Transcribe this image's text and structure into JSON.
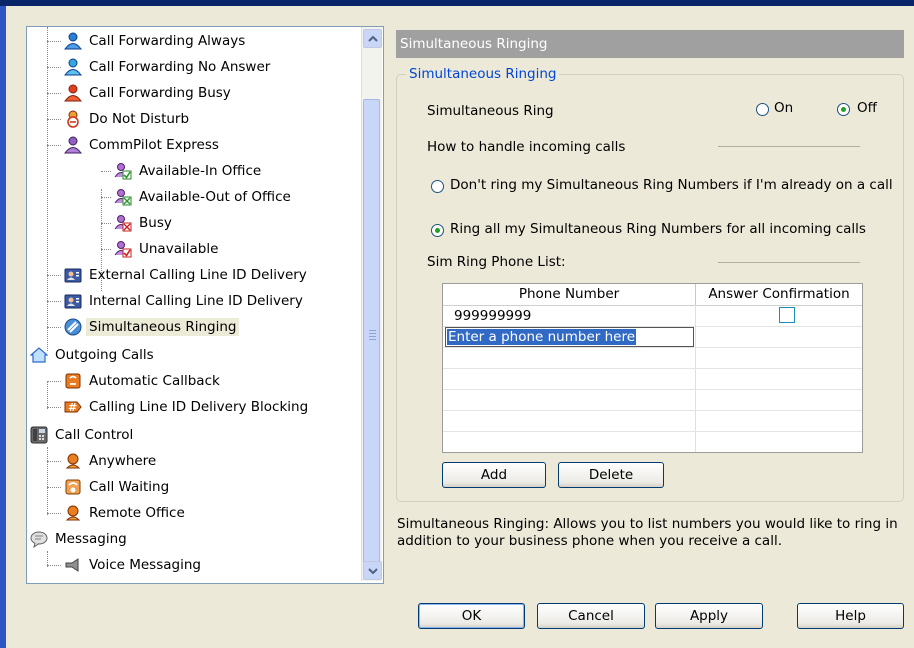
{
  "tree": {
    "items": [
      {
        "label": "Call Forwarding Always",
        "icon": "person-forward-icon"
      },
      {
        "label": "Call Forwarding No Answer",
        "icon": "person-no-answer-icon"
      },
      {
        "label": "Call Forwarding Busy",
        "icon": "person-busy-icon"
      },
      {
        "label": "Do Not Disturb",
        "icon": "person-dnd-icon"
      },
      {
        "label": "CommPilot Express",
        "icon": "person-commpilot-icon"
      },
      {
        "label": "Available-In Office",
        "icon": "available-in-office-icon"
      },
      {
        "label": "Available-Out of Office",
        "icon": "available-out-office-icon"
      },
      {
        "label": "Busy",
        "icon": "busy-status-icon"
      },
      {
        "label": "Unavailable",
        "icon": "unavailable-status-icon"
      },
      {
        "label": "External Calling Line ID Delivery",
        "icon": "caller-id-card-icon"
      },
      {
        "label": "Internal Calling Line ID Delivery",
        "icon": "caller-id-card-icon"
      },
      {
        "label": "Simultaneous Ringing",
        "icon": "simultaneous-ring-icon"
      },
      {
        "label": "Outgoing Calls",
        "icon": "house-icon"
      },
      {
        "label": "Automatic Callback",
        "icon": "callback-phone-icon"
      },
      {
        "label": "Calling Line ID Delivery Blocking",
        "icon": "hash-block-icon"
      },
      {
        "label": "Call Control",
        "icon": "phone-desk-icon"
      },
      {
        "label": "Anywhere",
        "icon": "anywhere-icon"
      },
      {
        "label": "Call Waiting",
        "icon": "call-waiting-icon"
      },
      {
        "label": "Remote Office",
        "icon": "remote-office-icon"
      },
      {
        "label": "Messaging",
        "icon": "speech-bubble-icon"
      },
      {
        "label": "Voice Messaging",
        "icon": "voicemail-icon"
      }
    ]
  },
  "panel": {
    "header": "Simultaneous Ringing",
    "group_title": "Simultaneous Ringing",
    "ring_label": "Simultaneous Ring",
    "on_label": "On",
    "off_label": "Off",
    "ring_selected": "Off",
    "handle_label": "How to handle incoming calls",
    "option_dont_ring": "Don't ring my Simultaneous Ring Numbers if I'm already on a call",
    "option_ring_all": "Ring all my Simultaneous Ring Numbers for all incoming calls",
    "handle_selected": "ring_all",
    "list_label": "Sim Ring Phone List:",
    "table": {
      "headers": [
        "Phone Number",
        "Answer Confirmation"
      ],
      "rows": [
        {
          "number": "999999999",
          "confirm": false
        }
      ],
      "new_entry_placeholder": "Enter a phone number here"
    },
    "add_label": "Add",
    "delete_label": "Delete",
    "description": "Simultaneous Ringing: Allows you to list numbers you would like to ring in addition to your business phone when you receive a call."
  },
  "footer": {
    "ok": "OK",
    "cancel": "Cancel",
    "apply": "Apply",
    "help": "Help"
  }
}
